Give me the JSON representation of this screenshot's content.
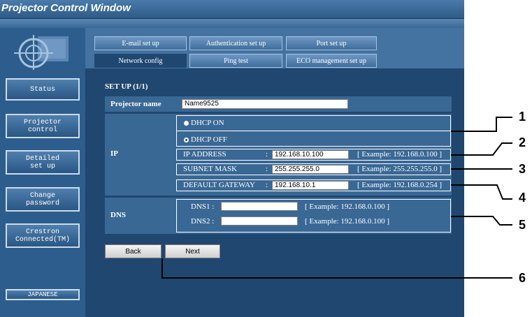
{
  "window": {
    "title": "Projector Control Window"
  },
  "sidebar": {
    "items": [
      {
        "label": "Status"
      },
      {
        "label": "Projector\ncontrol"
      },
      {
        "label": "Detailed\nset up"
      },
      {
        "label": "Change\npassword"
      },
      {
        "label": "Crestron\nConnected(TM)"
      }
    ],
    "language_button": "JAPANESE"
  },
  "tabs": {
    "row1": [
      "E-mail set up",
      "Authentication set up",
      "Port set up"
    ],
    "row2": [
      "Network config",
      "Ping test",
      "ECO management set up"
    ],
    "active": "Network config"
  },
  "form": {
    "title": "SET UP (1/1)",
    "projector_name": {
      "label": "Projector name",
      "value": "Name9525"
    },
    "ip": {
      "label": "IP",
      "dhcp_on": "DHCP ON",
      "dhcp_off": "DHCP OFF",
      "dhcp_selected": "off",
      "ip_address": {
        "label": "IP ADDRESS",
        "colon": ":",
        "value": "192.168.10.100",
        "example": "[ Example: 192.168.0.100 ]"
      },
      "subnet_mask": {
        "label": "SUBNET MASK",
        "colon": ":",
        "value": "255.255.255.0",
        "example": "[ Example: 255.255.255.0 ]"
      },
      "default_gateway": {
        "label": "DEFAULT GATEWAY",
        "colon": ":",
        "value": "192.168.10.1",
        "example": "[ Example: 192.168.0.254 ]"
      }
    },
    "dns": {
      "label": "DNS",
      "dns1": {
        "label": "DNS1 :",
        "value": "",
        "example": "[ Example: 192.168.0.100 ]"
      },
      "dns2": {
        "label": "DNS2 :",
        "value": "",
        "example": "[ Example: 192.168.0.100 ]"
      }
    },
    "buttons": {
      "back": "Back",
      "next": "Next"
    }
  },
  "callouts": [
    "1",
    "2",
    "3",
    "4",
    "5",
    "6"
  ],
  "colors": {
    "window_bg": "#1f4770",
    "row_bg": "#3a6895",
    "title_bar": "#2e5b87",
    "sidebar": "#2c5d8d"
  }
}
